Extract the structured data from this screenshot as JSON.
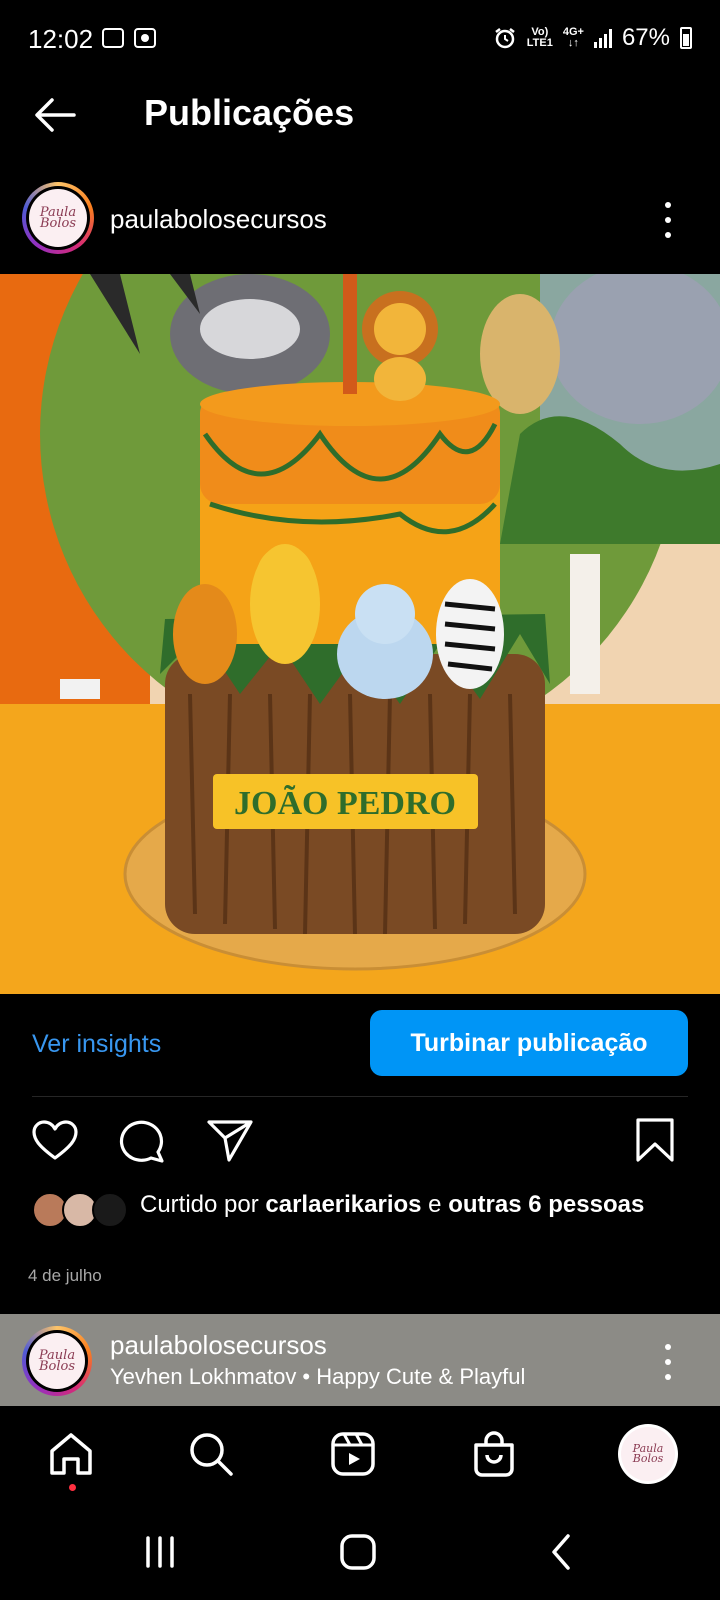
{
  "status_bar": {
    "time": "12:02",
    "network_top": "Vo)",
    "network_bottom": "LTE1",
    "data_type": "4G+",
    "battery_percent": "67%"
  },
  "header": {
    "title": "Publicações"
  },
  "post": {
    "username": "paulabolosecursos",
    "avatar_text": "Paula Bolos e Cursos",
    "image_caption": "JOÃO PEDRO",
    "insights_label": "Ver insights",
    "boost_label": "Turbinar publicação",
    "likes": {
      "prefix": "Curtido por ",
      "user": "carlaerikarios",
      "connector": " e ",
      "others": "outras 6 pessoas"
    },
    "date": "4 de julho"
  },
  "next_post": {
    "username": "paulabolosecursos",
    "audio": "Yevhen Lokhmatov • Happy Cute & Playful"
  },
  "icons": {
    "back": "arrow-left-icon",
    "more": "more-vertical-icon",
    "like": "heart-icon",
    "comment": "comment-icon",
    "share": "send-icon",
    "save": "bookmark-icon",
    "home": "home-icon",
    "search": "search-icon",
    "reels": "reels-icon",
    "shop": "shop-icon"
  },
  "colors": {
    "accent": "#0095f6",
    "link": "#3897f0",
    "background": "#000000",
    "notification_dot": "#ff3040"
  }
}
